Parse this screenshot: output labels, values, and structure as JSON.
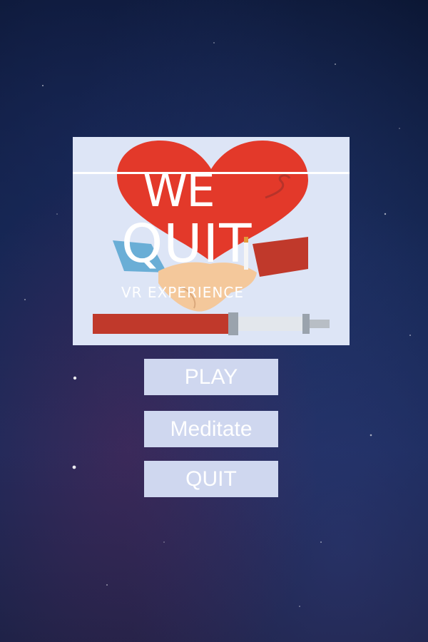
{
  "logo": {
    "line1": "WE",
    "line2": "QUIT",
    "subtitle": "VR EXPERIENCE"
  },
  "menu": {
    "play_label": "PLAY",
    "meditate_label": "Meditate",
    "quit_label": "QUIT"
  },
  "colors": {
    "heart": "#e3392a",
    "button_bg": "#cfd7ef",
    "logo_bg": "#dde5f6"
  }
}
